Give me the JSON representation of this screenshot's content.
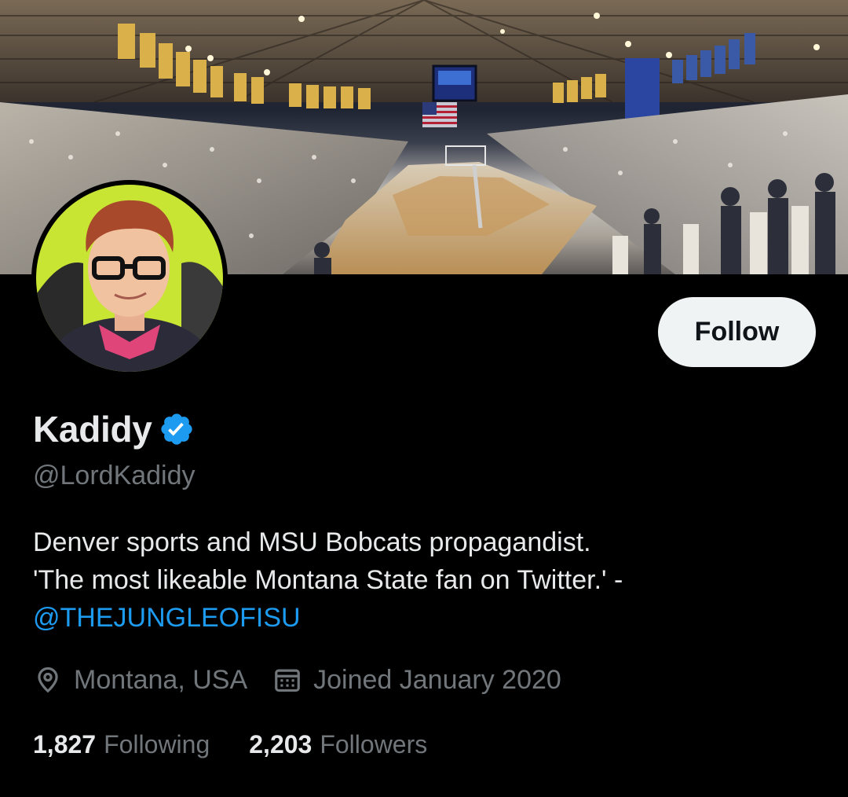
{
  "profile": {
    "display_name": "Kadidy",
    "handle": "@LordKadidy",
    "bio_line1": "Denver sports and MSU Bobcats propagandist.",
    "bio_line2": "'The most likeable Montana State fan on Twitter.' -",
    "bio_mention": "@THEJUNGLEOFISU",
    "location": "Montana, USA",
    "joined": "Joined January 2020",
    "verified": true
  },
  "actions": {
    "follow_label": "Follow"
  },
  "stats": {
    "following_count": "1,827",
    "following_label": "Following",
    "followers_count": "2,203",
    "followers_label": "Followers"
  },
  "colors": {
    "background": "#000000",
    "text_primary": "#e7e9ea",
    "text_secondary": "#71767b",
    "accent": "#1d9bf0",
    "follow_button_bg": "#eff3f4",
    "avatar_bg": "#c8e534"
  },
  "icons": {
    "verified": "verified-badge-icon",
    "location": "location-pin-icon",
    "calendar": "calendar-icon"
  }
}
